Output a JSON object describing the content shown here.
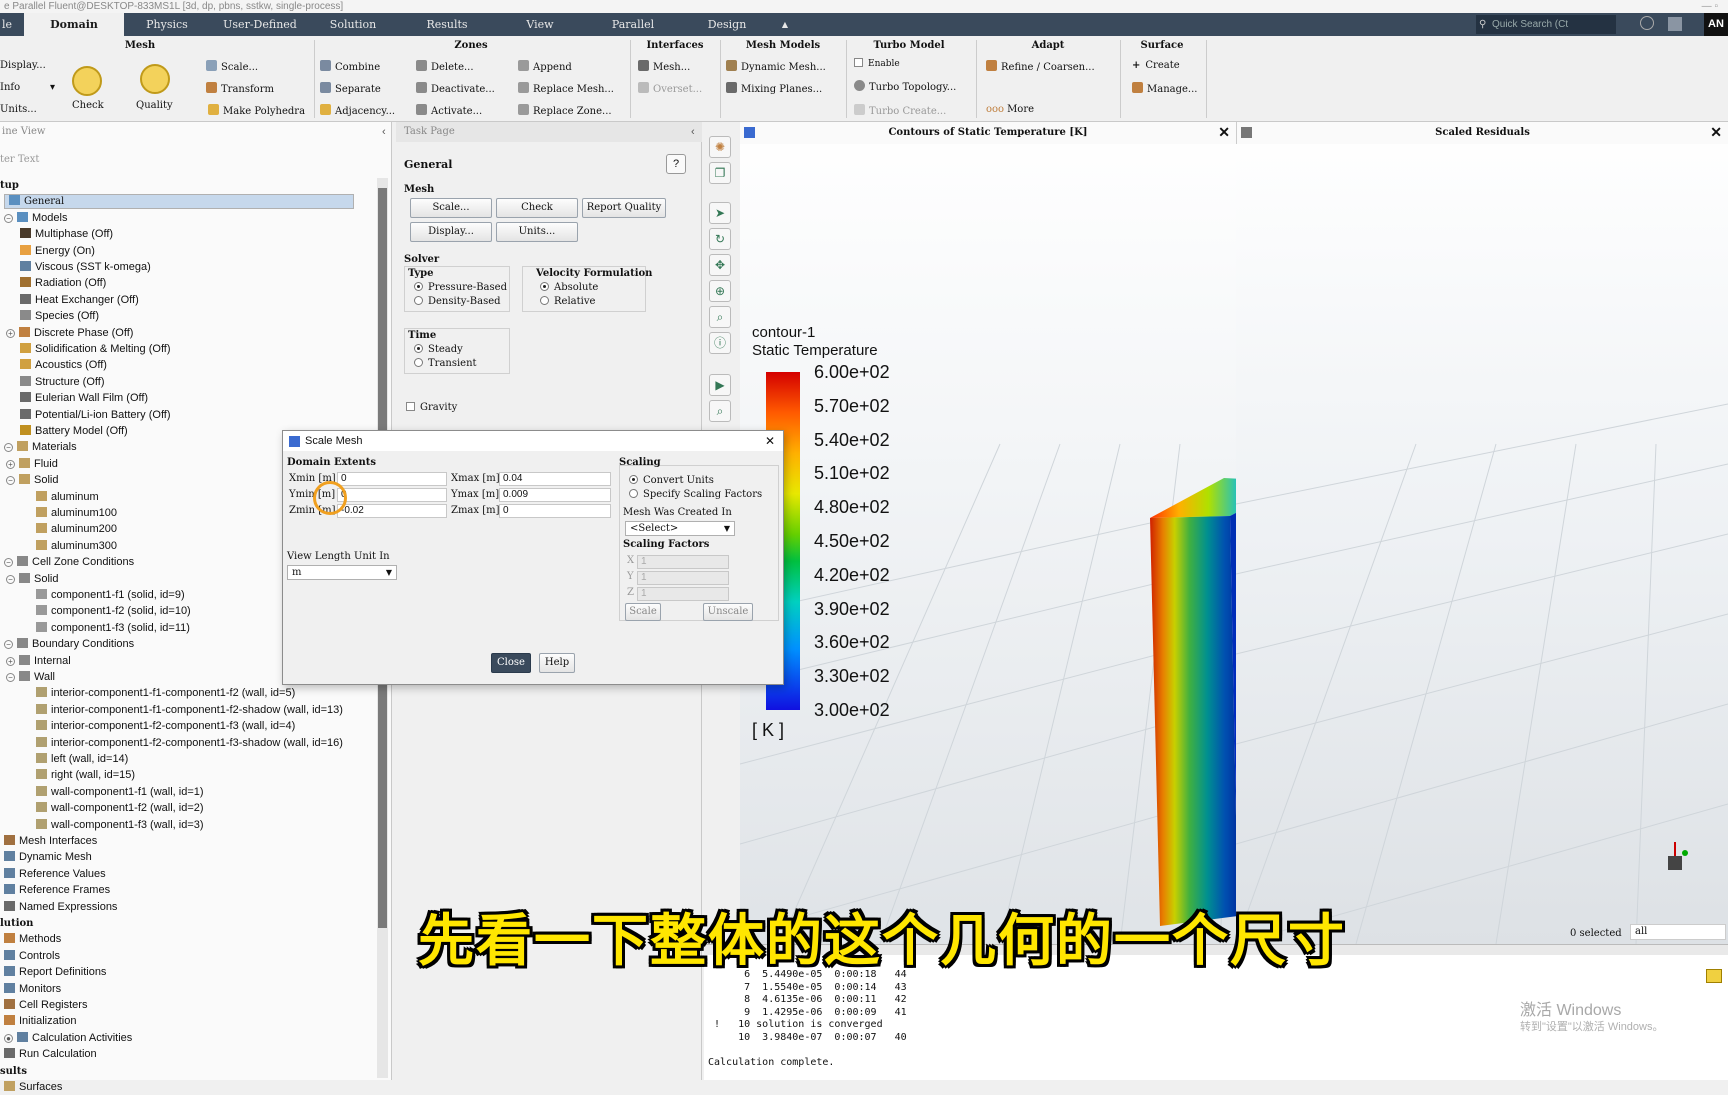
{
  "window": {
    "title": "e Parallel Fluent@DESKTOP-833MS1L  [3d, dp, pbns, sstkw, single-process]",
    "controls": "—  ▫"
  },
  "menu": {
    "first": "le",
    "tabs": [
      "Domain",
      "Physics",
      "User-Defined",
      "Solution",
      "Results",
      "View",
      "Parallel",
      "Design"
    ],
    "active": "Domain",
    "search_placeholder": "Quick Search (Ct",
    "collapse_glyph": "▲",
    "right_label": "AN"
  },
  "ribbon": {
    "mesh": {
      "title": "Mesh",
      "display": "Display...",
      "info": "Info",
      "units": "Units...",
      "check": "Check",
      "quality": "Quality",
      "scale": "Scale...",
      "transform": "Transform",
      "make_polyhedra": "Make Polyhedra"
    },
    "zones": {
      "title": "Zones",
      "combine": "Combine",
      "separate": "Separate",
      "adjacency": "Adjacency...",
      "delete": "Delete...",
      "deactivate": "Deactivate...",
      "activate": "Activate...",
      "append": "Append",
      "replace_mesh": "Replace Mesh...",
      "replace_zone": "Replace Zone..."
    },
    "interfaces": {
      "title": "Interfaces",
      "mesh": "Mesh...",
      "overset": "Overset..."
    },
    "mesh_models": {
      "title": "Mesh Models",
      "dynamic": "Dynamic Mesh...",
      "mixing": "Mixing Planes..."
    },
    "turbo": {
      "title": "Turbo Model",
      "enable": "Enable",
      "topology": "Turbo Topology...",
      "create": "Turbo Create..."
    },
    "adapt": {
      "title": "Adapt",
      "refine": "Refine / Coarsen...",
      "more": "More"
    },
    "surface": {
      "title": "Surface",
      "create": "Create",
      "manage": "Manage..."
    }
  },
  "outline": {
    "title": "ine View",
    "filter_placeholder": "ter Text",
    "items": [
      {
        "label": "tup",
        "level": 0,
        "sec": true
      },
      {
        "label": "General",
        "level": 1,
        "sel": true,
        "color": "#5a8fc0"
      },
      {
        "label": "Models",
        "level": 1,
        "pm": "−",
        "color": "#5a8fc0"
      },
      {
        "label": "Multiphase (Off)",
        "level": 2,
        "color": "#4a3a2a"
      },
      {
        "label": "Energy (On)",
        "level": 2,
        "color": "#e8a040"
      },
      {
        "label": "Viscous (SST k-omega)",
        "level": 2,
        "color": "#6080a0"
      },
      {
        "label": "Radiation (Off)",
        "level": 2,
        "color": "#a07030"
      },
      {
        "label": "Heat Exchanger (Off)",
        "level": 2,
        "color": "#6a6a6a"
      },
      {
        "label": "Species (Off)",
        "level": 2,
        "color": "#8a8a8a"
      },
      {
        "label": "Discrete Phase (Off)",
        "level": 2,
        "pm": "+",
        "color": "#c08040"
      },
      {
        "label": "Solidification & Melting (Off)",
        "level": 2,
        "color": "#d0a040"
      },
      {
        "label": "Acoustics (Off)",
        "level": 2,
        "color": "#d0a040"
      },
      {
        "label": "Structure (Off)",
        "level": 2,
        "color": "#8a8a8a"
      },
      {
        "label": "Eulerian Wall Film (Off)",
        "level": 2,
        "color": "#6a6a6a"
      },
      {
        "label": "Potential/Li-ion Battery (Off)",
        "level": 2,
        "color": "#6a6a6a"
      },
      {
        "label": "Battery Model (Off)",
        "level": 2,
        "color": "#c09020"
      },
      {
        "label": "Materials",
        "level": 1,
        "pm": "−",
        "color": "#c0a060"
      },
      {
        "label": "Fluid",
        "level": 1,
        "pm": "+",
        "indent": 1,
        "color": "#c0a060"
      },
      {
        "label": "Solid",
        "level": 1,
        "pm": "−",
        "indent": 1,
        "color": "#c0a060"
      },
      {
        "label": "aluminum",
        "level": 3,
        "color": "#c0a060"
      },
      {
        "label": "aluminum100",
        "level": 3,
        "color": "#c0a060"
      },
      {
        "label": "aluminum200",
        "level": 3,
        "color": "#c0a060"
      },
      {
        "label": "aluminum300",
        "level": 3,
        "color": "#c0a060"
      },
      {
        "label": "Cell Zone Conditions",
        "level": 1,
        "pm": "−",
        "color": "#888888"
      },
      {
        "label": "Solid",
        "level": 1,
        "pm": "−",
        "indent": 1,
        "color": "#888888"
      },
      {
        "label": "component1-f1 (solid, id=9)",
        "level": 3,
        "color": "#999999"
      },
      {
        "label": "component1-f2 (solid, id=10)",
        "level": 3,
        "color": "#999999"
      },
      {
        "label": "component1-f3 (solid, id=11)",
        "level": 3,
        "color": "#999999"
      },
      {
        "label": "Boundary Conditions",
        "level": 1,
        "pm": "−",
        "color": "#888888"
      },
      {
        "label": "Internal",
        "level": 1,
        "pm": "+",
        "indent": 1,
        "color": "#888888"
      },
      {
        "label": "Wall",
        "level": 1,
        "pm": "−",
        "indent": 1,
        "color": "#888888"
      },
      {
        "label": "interior-component1-f1-component1-f2 (wall, id=5)",
        "level": 3,
        "color": "#b0a070"
      },
      {
        "label": "interior-component1-f1-component1-f2-shadow (wall, id=13)",
        "level": 3,
        "color": "#b0a070"
      },
      {
        "label": "interior-component1-f2-component1-f3 (wall, id=4)",
        "level": 3,
        "color": "#b0a070"
      },
      {
        "label": "interior-component1-f2-component1-f3-shadow (wall, id=16)",
        "level": 3,
        "color": "#b0a070"
      },
      {
        "label": "left (wall, id=14)",
        "level": 3,
        "color": "#b0a070"
      },
      {
        "label": "right (wall, id=15)",
        "level": 3,
        "color": "#b0a070"
      },
      {
        "label": "wall-component1-f1 (wall, id=1)",
        "level": 3,
        "color": "#b0a070"
      },
      {
        "label": "wall-component1-f2 (wall, id=2)",
        "level": 3,
        "color": "#b0a070"
      },
      {
        "label": "wall-component1-f3 (wall, id=3)",
        "level": 3,
        "color": "#b0a070"
      },
      {
        "label": "Mesh Interfaces",
        "level": 1,
        "color": "#a07040"
      },
      {
        "label": "Dynamic Mesh",
        "level": 1,
        "color": "#6080a0"
      },
      {
        "label": "Reference Values",
        "level": 1,
        "color": "#6080a0"
      },
      {
        "label": "Reference Frames",
        "level": 1,
        "color": "#6080a0"
      },
      {
        "label": "Named Expressions",
        "level": 1,
        "color": "#6a6a6a"
      },
      {
        "label": "lution",
        "level": 0,
        "sec": true
      },
      {
        "label": "Methods",
        "level": 1,
        "color": "#c08040"
      },
      {
        "label": "Controls",
        "level": 1,
        "color": "#6080a0"
      },
      {
        "label": "Report Definitions",
        "level": 1,
        "color": "#6080a0"
      },
      {
        "label": "Monitors",
        "level": 1,
        "color": "#6080a0"
      },
      {
        "label": "Cell Registers",
        "level": 1,
        "color": "#a07040"
      },
      {
        "label": "Initialization",
        "level": 1,
        "color": "#c08040"
      },
      {
        "label": "Calculation Activities",
        "level": 1,
        "pm": "●",
        "color": "#6080a0"
      },
      {
        "label": "Run Calculation",
        "level": 1,
        "color": "#6a6a6a"
      },
      {
        "label": "sults",
        "level": 0,
        "sec": true
      },
      {
        "label": "Surfaces",
        "level": 1,
        "color": "#c0a060"
      }
    ]
  },
  "task": {
    "title": "Task Page",
    "general": "General",
    "help_glyph": "?",
    "mesh_label": "Mesh",
    "buttons": {
      "scale": "Scale...",
      "check": "Check",
      "report_quality": "Report Quality",
      "display": "Display...",
      "units": "Units..."
    },
    "solver_label": "Solver",
    "type_label": "Type",
    "pressure_based": "Pressure-Based",
    "density_based": "Density-Based",
    "velocity_label": "Velocity Formulation",
    "absolute": "Absolute",
    "relative": "Relative",
    "time_label": "Time",
    "steady": "Steady",
    "transient": "Transient",
    "gravity": "Gravity"
  },
  "graphics": {
    "title": "Contours of Static Temperature [K]",
    "right_title": "Scaled Residuals",
    "legend_name": "contour-1",
    "legend_var": "Static Temperature",
    "legend_unit": "[ K ]",
    "legend_values": [
      "6.00e+02",
      "5.70e+02",
      "5.40e+02",
      "5.10e+02",
      "4.80e+02",
      "4.50e+02",
      "4.20e+02",
      "3.90e+02",
      "3.60e+02",
      "3.30e+02",
      "3.00e+02"
    ],
    "selected_label": "0 selected",
    "selected_value": "all"
  },
  "console": {
    "lines": [
      "      6  5.4490e-05  0:00:18   44",
      "      7  1.5540e-05  0:00:14   43",
      "      8  4.6135e-06  0:00:11   42",
      "      9  1.4295e-06  0:00:09   41",
      " !   10 solution is converged",
      "     10  3.9840e-07  0:00:07   40",
      "",
      "Calculation complete."
    ]
  },
  "dialog": {
    "title": "Scale Mesh",
    "close_glyph": "✕",
    "domain_extents": "Domain Extents",
    "xmin_label": "Xmin [m]",
    "xmin": "0",
    "xmax_label": "Xmax [m]",
    "xmax": "0.04",
    "ymin_label": "Ymin [m]",
    "ymin": "0",
    "ymax_label": "Ymax [m]",
    "ymax": "0.009",
    "zmin_label": "Zmin [m]",
    "zmin": "-0.02",
    "zmax_label": "Zmax [m]",
    "zmax": "0",
    "view_unit_label": "View Length Unit In",
    "view_unit": "m",
    "scaling": "Scaling",
    "convert_units": "Convert Units",
    "specify_factors": "Specify Scaling Factors",
    "created_in_label": "Mesh Was Created In",
    "created_in": "<Select>",
    "factors_label": "Scaling Factors",
    "fx_label": "X",
    "fx": "1",
    "fy_label": "Y",
    "fy": "1",
    "fz_label": "Z",
    "fz": "1",
    "scale_btn": "Scale",
    "unscale_btn": "Unscale",
    "close_btn": "Close",
    "help_btn": "Help"
  },
  "subtitle": "先看一下整体的这个几何的一个尺寸",
  "watermark": {
    "line1": "激活 Windows",
    "line2": "转到\"设置\"以激活 Windows。"
  }
}
